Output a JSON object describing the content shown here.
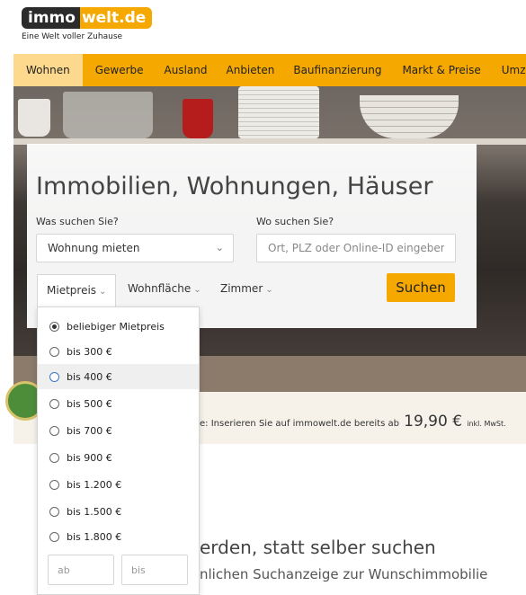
{
  "logo": {
    "part1": "immo",
    "part2": "welt.de",
    "tagline": "Eine Welt voller Zuhause"
  },
  "nav": [
    "Wohnen",
    "Gewerbe",
    "Ausland",
    "Anbieten",
    "Baufinanzierung",
    "Markt & Preise",
    "Umzug"
  ],
  "search": {
    "heading": "Immobilien, Wohnungen, Häuser",
    "what_label": "Was suchen Sie?",
    "what_value": "Wohnung mieten",
    "where_label": "Wo suchen Sie?",
    "where_placeholder": "Ort, PLZ oder Online-ID eingeben",
    "filters": [
      "Mietpreis",
      "Wohnfläche",
      "Zimmer"
    ],
    "button": "Suchen"
  },
  "price_dropdown": {
    "options": [
      "beliebiger Mietpreis",
      "bis 300 €",
      "bis 400 €",
      "bis 500 €",
      "bis 700 €",
      "bis 900 €",
      "bis 1.200 €",
      "bis 1.500 €",
      "bis 1.800 €"
    ],
    "selected_index": 0,
    "hover_index": 2,
    "from_placeholder": "ab",
    "to_placeholder": "bis"
  },
  "strip": {
    "text": "e: Inserieren Sie auf immowelt.de bereits ab",
    "price": "19,90 €",
    "suffix": "inkl. MwSt."
  },
  "promo": {
    "title": "erden, statt selber suchen",
    "subtitle": "nlichen Suchanzeige zur Wunschimmobilie"
  },
  "colors": {
    "brand": "#f5a800",
    "nav_active": "#fcd98c"
  }
}
